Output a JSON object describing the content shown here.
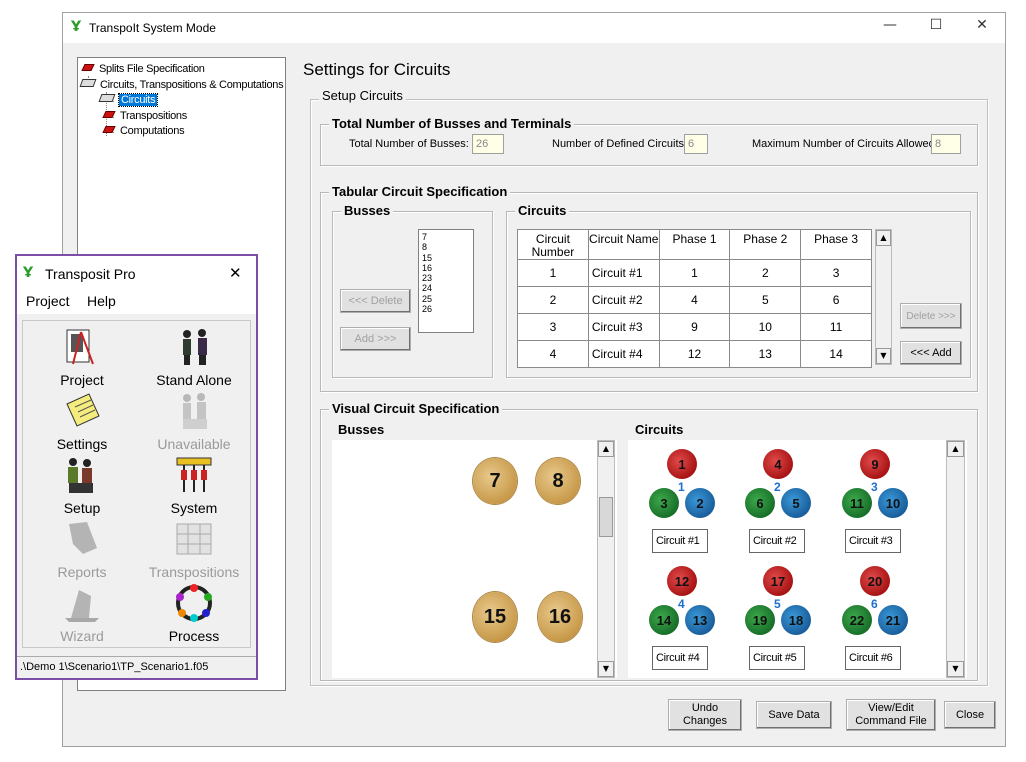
{
  "main_window": {
    "title": "TranspoIt System Mode",
    "controls": {
      "minimize": "—",
      "maximize": "☐",
      "close": "✕"
    }
  },
  "tree": {
    "items": [
      {
        "label": "Splits File Specification",
        "icon": "red-gem-icon"
      },
      {
        "label": "Circuits, Transpositions & Computations",
        "icon": "book-icon"
      },
      {
        "label": "Circuits",
        "icon": "book-icon",
        "selected": true
      },
      {
        "label": "Transpositions",
        "icon": "red-gem-icon"
      },
      {
        "label": "Computations",
        "icon": "red-gem-icon"
      }
    ]
  },
  "content": {
    "heading": "Settings for Circuits",
    "setup_title": "Setup Circuits",
    "totals": {
      "title": "Total Number of Busses and Terminals",
      "total_busses_label": "Total Number of Busses:",
      "total_busses_value": "26",
      "defined_circuits_label": "Number of Defined Circuits:",
      "defined_circuits_value": "6",
      "max_circuits_label": "Maximum Number of Circuits Allowed:",
      "max_circuits_value": "8"
    },
    "tabular": {
      "title": "Tabular Circuit Specification",
      "busses_title": "Busses",
      "busses_list": [
        "7",
        "8",
        "15",
        "16",
        "23",
        "24",
        "25",
        "26"
      ],
      "delete_button": "<<< Delete",
      "add_button": "Add >>>",
      "circuits_title": "Circuits",
      "columns": [
        "Circuit Number",
        "Circuit Name",
        "Phase 1",
        "Phase 2",
        "Phase 3"
      ],
      "rows": [
        [
          "1",
          "Circuit #1",
          "1",
          "2",
          "3"
        ],
        [
          "2",
          "Circuit #2",
          "4",
          "5",
          "6"
        ],
        [
          "3",
          "Circuit #3",
          "9",
          "10",
          "11"
        ],
        [
          "4",
          "Circuit #4",
          "12",
          "13",
          "14"
        ]
      ],
      "right_delete_button": "Delete >>>",
      "right_add_button": "<<< Add"
    },
    "visual": {
      "title": "Visual Circuit Specification",
      "busses_title": "Busses",
      "circuits_title": "Circuits",
      "busses": [
        "7",
        "8",
        "15",
        "16"
      ],
      "circuits": [
        {
          "number": "1",
          "name": "Circuit #1",
          "top": "1",
          "left": "3",
          "right": "2"
        },
        {
          "number": "2",
          "name": "Circuit #2",
          "top": "4",
          "left": "6",
          "right": "5"
        },
        {
          "number": "3",
          "name": "Circuit #3",
          "top": "9",
          "left": "11",
          "right": "10"
        },
        {
          "number": "4",
          "name": "Circuit #4",
          "top": "12",
          "left": "14",
          "right": "13"
        },
        {
          "number": "5",
          "name": "Circuit #5",
          "top": "17",
          "left": "19",
          "right": "18"
        },
        {
          "number": "6",
          "name": "Circuit #6",
          "top": "20",
          "left": "22",
          "right": "21"
        }
      ]
    },
    "bottom_buttons": {
      "undo": "Undo Changes",
      "save": "Save Data",
      "view_edit": "View/Edit Command File",
      "close": "Close"
    }
  },
  "pro_window": {
    "title": "Transposit Pro",
    "close": "✕",
    "menu": [
      "Project",
      "Help"
    ],
    "tools": [
      {
        "label": "Project",
        "icon": "project-drawing-icon",
        "enabled": true
      },
      {
        "label": "Stand Alone",
        "icon": "people-icon",
        "enabled": true
      },
      {
        "label": "Settings",
        "icon": "notepad-icon",
        "enabled": true
      },
      {
        "label": "Unavailable",
        "icon": "people-icon",
        "enabled": false
      },
      {
        "label": "Setup",
        "icon": "soldiers-icon",
        "enabled": true
      },
      {
        "label": "System",
        "icon": "tower-icon",
        "enabled": true
      },
      {
        "label": "Reports",
        "icon": "report-icon",
        "enabled": false
      },
      {
        "label": "Transpositions",
        "icon": "grid-icon",
        "enabled": false
      },
      {
        "label": "Wizard",
        "icon": "wizard-hat-icon",
        "enabled": false
      },
      {
        "label": "Process",
        "icon": "process-wheel-icon",
        "enabled": true
      }
    ],
    "status_path": ".\\Demo 1\\Scenario1\\TP_Scenario1.f05"
  }
}
